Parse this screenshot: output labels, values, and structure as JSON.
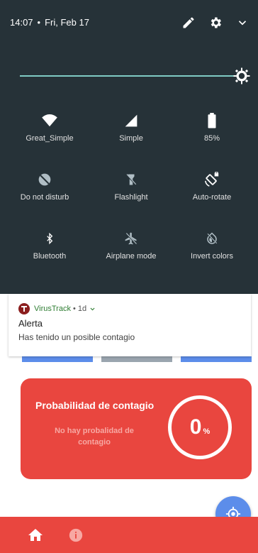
{
  "status_bar": {
    "time": "14:07",
    "separator": "•",
    "date": "Fri, Feb 17",
    "icons": [
      "edit-icon",
      "settings-icon",
      "expand-icon"
    ]
  },
  "brightness": {
    "level": 1.0
  },
  "quick_tiles": [
    {
      "label": "Great_Simple",
      "icon": "wifi-icon",
      "active": true
    },
    {
      "label": "Simple",
      "icon": "cellular-signal-icon",
      "active": true
    },
    {
      "label": "85%",
      "icon": "battery-icon",
      "active": true
    },
    {
      "label": "Do not disturb",
      "icon": "do-not-disturb-icon",
      "active": false
    },
    {
      "label": "Flashlight",
      "icon": "flashlight-icon",
      "active": false
    },
    {
      "label": "Auto-rotate",
      "icon": "auto-rotate-icon",
      "active": true
    },
    {
      "label": "Bluetooth",
      "icon": "bluetooth-icon",
      "active": true
    },
    {
      "label": "Airplane mode",
      "icon": "airplane-icon",
      "active": false
    },
    {
      "label": "Invert colors",
      "icon": "invert-colors-icon",
      "active": false
    }
  ],
  "notification": {
    "app_name": "VirusTrack",
    "separator": "•",
    "age": "1d",
    "title": "Alerta",
    "body": "Has tenido un posible contagio"
  },
  "probability_card": {
    "title": "Probabilidad de contagio",
    "subtitle": "No hay probalidad de contagio",
    "value": "0",
    "unit": "%"
  },
  "colors": {
    "shade_bg": "#263238",
    "accent_red": "#e9463f",
    "fab_blue": "#5c8dea",
    "brightness_bar": "#80cbc4"
  },
  "bottom_nav": {
    "items": [
      "home-icon",
      "info-icon"
    ]
  }
}
